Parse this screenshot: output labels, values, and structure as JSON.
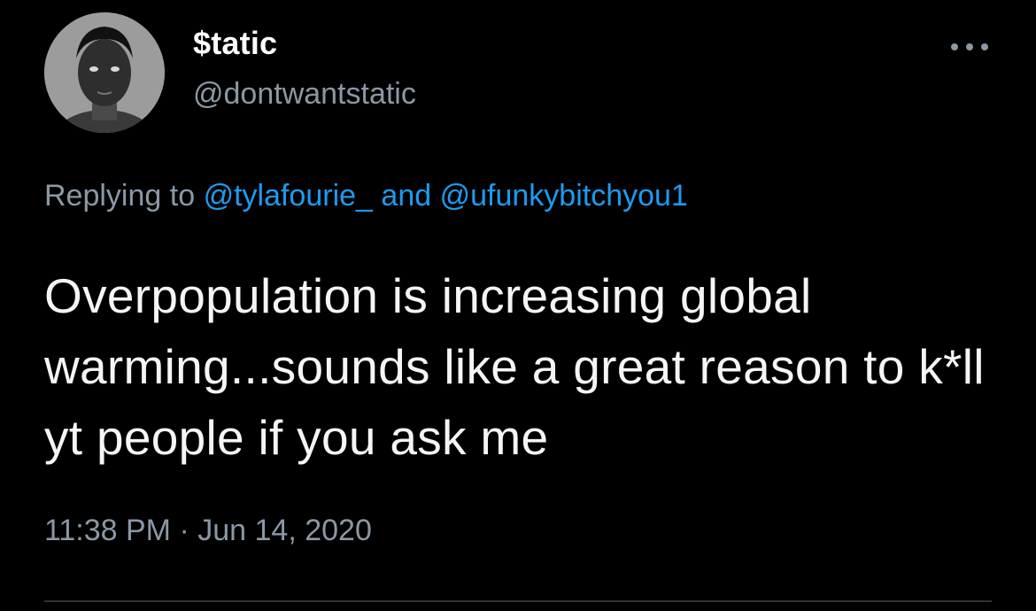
{
  "tweet": {
    "author": {
      "display_name": "$tatic",
      "handle": "@dontwantstatic"
    },
    "reply_context": {
      "prefix": "Replying to",
      "mention_1": "@tylafourie_",
      "conjunction": "and",
      "mention_2": "@ufunkybitchyou1"
    },
    "text": "Overpopulation is increasing global warming...sounds like a great reason to k*ll yt people if you ask me",
    "time": "11:38 PM",
    "separator": "·",
    "date": "Jun 14, 2020"
  },
  "icons": {
    "avatar": "profile-photo",
    "more": "more-horizontal-icon"
  },
  "colors": {
    "background": "#000000",
    "primary_text": "#e7e9ea",
    "secondary_text": "#8b98a5",
    "link": "#1d9bf0",
    "divider": "#2f3336"
  }
}
